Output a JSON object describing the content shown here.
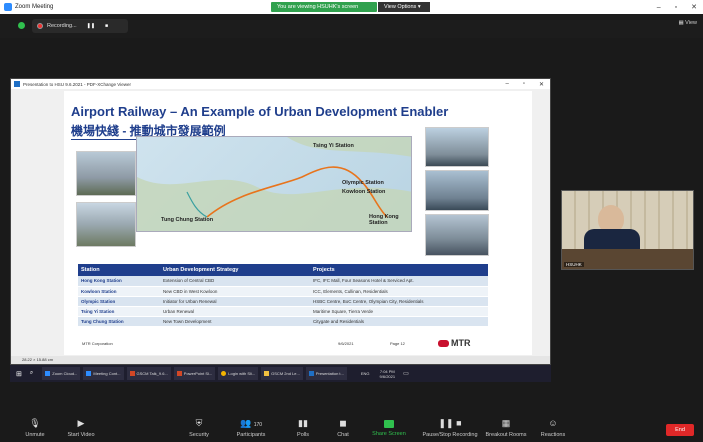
{
  "zoom": {
    "window_title": "Zoom Meeting",
    "share_banner": "You are viewing HSUHK's screen",
    "view_options": "View Options ▾",
    "view_label": "View",
    "recording": "Recording...",
    "window_controls": [
      "–",
      "▫",
      "✕"
    ]
  },
  "viewer": {
    "title": "Presentation to HSU 9.6.2021 - PDF-XChange Viewer",
    "status": "28.22 × 15.88 cm"
  },
  "slide": {
    "title": "Airport Railway – An Example of Urban Development Enabler",
    "subtitle": "機場快綫 - 推動城市發展範例",
    "map_labels": {
      "tung_chung": "Tung Chung Station",
      "tsing_yi": "Tsing Yi Station",
      "olympic": "Olympic Station",
      "kowloon": "Kowloon Station",
      "hong_kong": "Hong Kong Station"
    },
    "table": {
      "headers": [
        "Station",
        "Urban Development Strategy",
        "Projects"
      ],
      "rows": [
        [
          "Hong Kong Station",
          "Extension of Central CBD",
          "IFC, IFC Mall, Four Seasons Hotel & Serviced Apt."
        ],
        [
          "Kowloon Station",
          "New CBD in West Kowloon",
          "ICC, Elements, Cullinan, Residentials"
        ],
        [
          "Olympic Station",
          "Initiator for Urban Renewal",
          "HSBC Centre, BoC Centre, Olympian City, Residentials"
        ],
        [
          "Tsing Yi Station",
          "Urban Renewal",
          "Maritime Square, Tierra Verde"
        ],
        [
          "Tung Chung Station",
          "New Town Development",
          "Citygate and Residentials"
        ]
      ]
    },
    "footer": {
      "corp": "MTR Corporation",
      "date": "9/6/2021",
      "page": "Page 12",
      "logo": "MTR"
    }
  },
  "taskbar": {
    "items": [
      "Zoom Cloud...",
      "Meeting Cont...",
      "GSCM Talk_9.6...",
      "PowerPoint Sl...",
      "Login with Sli...",
      "GSCM 2nd Le...",
      "Presentation t..."
    ],
    "lang": "ENG",
    "time": "7:04 PM",
    "date": "9/6/2021"
  },
  "video": {
    "name": "HSUHK"
  },
  "toolbar": {
    "unmute": "Unmute",
    "start_video": "Start Video",
    "security": "Security",
    "participants": "Participants",
    "participant_count": "170",
    "polls": "Polls",
    "chat": "Chat",
    "share_screen": "Share Screen",
    "pause_recording": "Pause/Stop Recording",
    "breakout": "Breakout Rooms",
    "reactions": "Reactions",
    "end": "End"
  },
  "colors": {
    "zoom_green": "#30a14e",
    "slide_blue": "#1f3e8c",
    "end_red": "#e02828",
    "mtr_red": "#c8102e"
  }
}
